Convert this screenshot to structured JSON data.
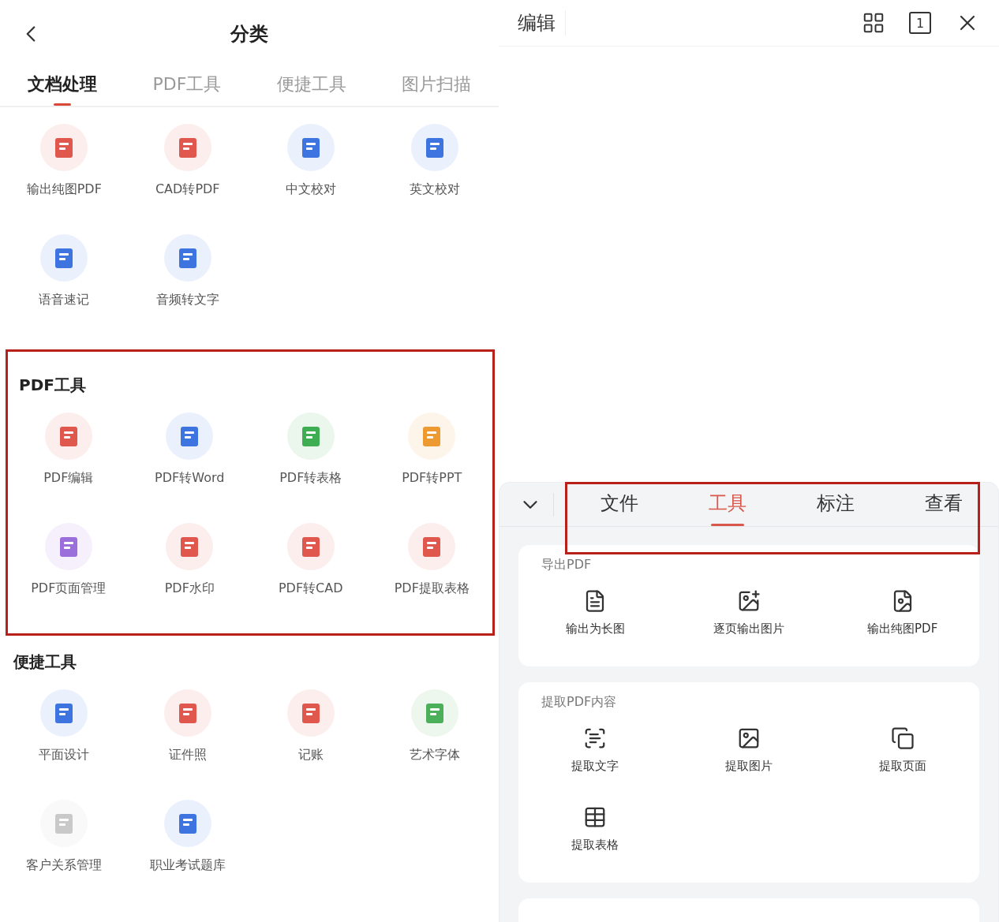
{
  "left": {
    "title": "分类",
    "tabs": [
      {
        "label": "文档处理",
        "selected": true
      },
      {
        "label": "PDF工具",
        "selected": false
      },
      {
        "label": "便捷工具",
        "selected": false
      },
      {
        "label": "图片扫描",
        "selected": false
      }
    ],
    "sections": [
      {
        "items": [
          {
            "label": "输出纯图PDF",
            "color": "#e0574d"
          },
          {
            "label": "CAD转PDF",
            "color": "#e0574d"
          },
          {
            "label": "中文校对",
            "color": "#3e74e0"
          },
          {
            "label": "英文校对",
            "color": "#3e74e0"
          },
          {
            "label": "语音速记",
            "color": "#3e74e0"
          },
          {
            "label": "音频转文字",
            "color": "#3e74e0"
          }
        ]
      },
      {
        "title": "PDF工具",
        "highlighted": true,
        "items": [
          {
            "label": "PDF编辑",
            "color": "#e0574d"
          },
          {
            "label": "PDF转Word",
            "color": "#3e74e0"
          },
          {
            "label": "PDF转表格",
            "color": "#3fae52"
          },
          {
            "label": "PDF转PPT",
            "color": "#ed9a32"
          },
          {
            "label": "PDF页面管理",
            "color": "#9a6fdc"
          },
          {
            "label": "PDF水印",
            "color": "#e0574d"
          },
          {
            "label": "PDF转CAD",
            "color": "#e0574d"
          },
          {
            "label": "PDF提取表格",
            "color": "#e0574d"
          }
        ]
      },
      {
        "title": "便捷工具",
        "highlighted": false,
        "items": [
          {
            "label": "平面设计",
            "color": "#3e74e0"
          },
          {
            "label": "证件照",
            "color": "#e0574d"
          },
          {
            "label": "记账",
            "color": "#e0574d"
          },
          {
            "label": "艺术字体",
            "color": "#4caf5a"
          },
          {
            "label": "客户关系管理",
            "color": "#c9c9c9"
          },
          {
            "label": "职业考试题库",
            "color": "#3e74e0"
          }
        ]
      }
    ]
  },
  "right": {
    "title": "编辑",
    "page_number": "1",
    "sheet_tabs": [
      {
        "label": "文件",
        "selected": false
      },
      {
        "label": "工具",
        "selected": true
      },
      {
        "label": "标注",
        "selected": false
      },
      {
        "label": "查看",
        "selected": false
      }
    ],
    "cards": [
      {
        "title": "导出PDF",
        "items": [
          "输出为长图",
          "逐页输出图片",
          "输出纯图PDF"
        ]
      },
      {
        "title": "提取PDF内容",
        "items": [
          "提取文字",
          "提取图片",
          "提取页面",
          "提取表格"
        ]
      }
    ]
  }
}
